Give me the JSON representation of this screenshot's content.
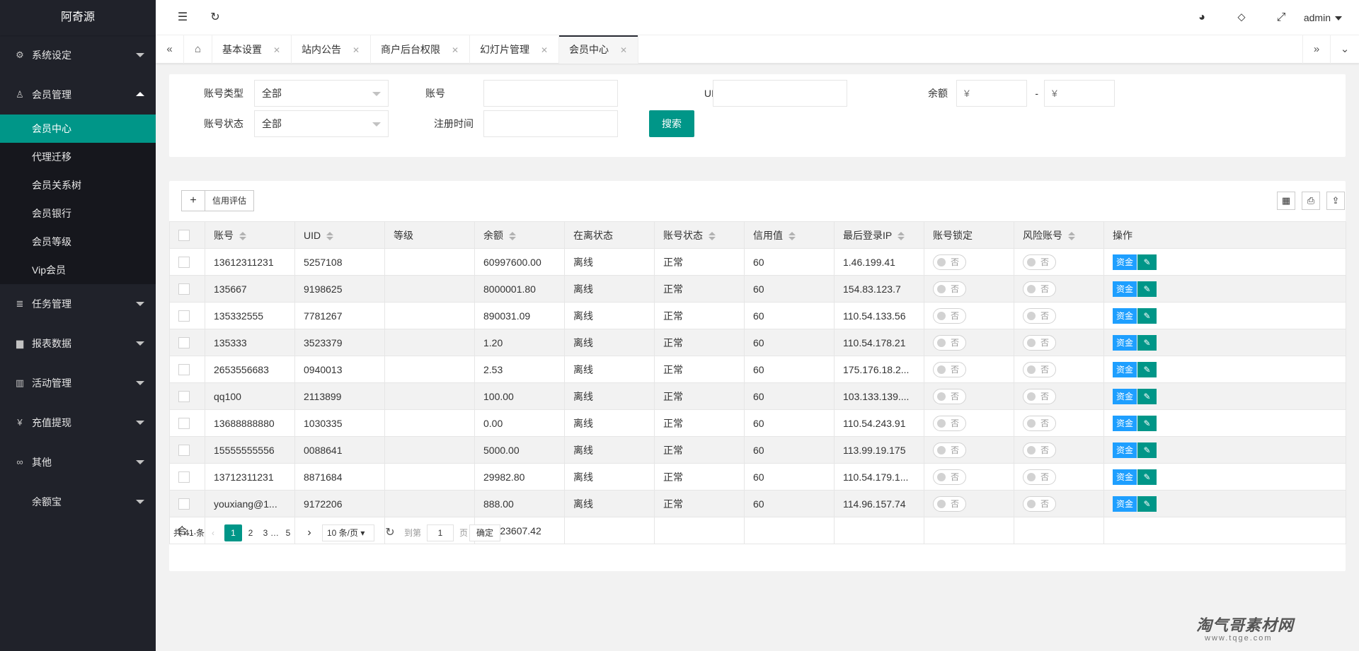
{
  "app": {
    "title": "阿奇源",
    "user": "admin"
  },
  "sidebar": {
    "groups": [
      {
        "label": "系统设定",
        "icon": "gear-icon"
      },
      {
        "label": "会员管理",
        "icon": "user-icon",
        "items": [
          "会员中心",
          "代理迁移",
          "会员关系树",
          "会员银行",
          "会员等级",
          "Vip会员"
        ]
      },
      {
        "label": "任务管理",
        "icon": "task-icon"
      },
      {
        "label": "报表数据",
        "icon": "report-icon"
      },
      {
        "label": "活动管理",
        "icon": "book-icon"
      },
      {
        "label": "充值提现",
        "icon": "yen-icon"
      },
      {
        "label": "其他",
        "icon": "link-icon"
      },
      {
        "label": "余额宝",
        "icon": ""
      }
    ]
  },
  "tabs": [
    "基本设置",
    "站内公告",
    "商户后台权限",
    "幻灯片管理",
    "会员中心"
  ],
  "filters": {
    "account_type_label": "账号类型",
    "account_type_value": "全部",
    "account_label": "账号",
    "account_value": "",
    "uid_label": "UID",
    "uid_value": "",
    "balance_label": "余额",
    "balance_min_ph": "¥",
    "balance_sep": "-",
    "balance_max_ph": "¥",
    "status_label": "账号状态",
    "status_value": "全部",
    "reg_time_label": "注册时间",
    "reg_time_value": "",
    "search_button": "搜索"
  },
  "toolbar": {
    "add": "+",
    "credit": "信用评估"
  },
  "table": {
    "columns": [
      "账号",
      "UID",
      "等级",
      "余额",
      "在离状态",
      "账号状态",
      "信用值",
      "最后登录IP",
      "账号锁定",
      "风险账号",
      "操作"
    ],
    "rows": [
      [
        "13612311231",
        "5257108",
        "",
        "60997600.00",
        "离线",
        "正常",
        "60",
        "1.46.199.41"
      ],
      [
        "135667",
        "9198625",
        "",
        "8000001.80",
        "离线",
        "正常",
        "60",
        "154.83.123.7"
      ],
      [
        "135332555",
        "7781267",
        "",
        "890031.09",
        "离线",
        "正常",
        "60",
        "110.54.133.56"
      ],
      [
        "135333",
        "3523379",
        "",
        "1.20",
        "离线",
        "正常",
        "60",
        "110.54.178.21"
      ],
      [
        "2653556683",
        "0940013",
        "",
        "2.53",
        "离线",
        "正常",
        "60",
        "175.176.18.2..."
      ],
      [
        "qq100",
        "2113899",
        "",
        "100.00",
        "离线",
        "正常",
        "60",
        "103.133.139...."
      ],
      [
        "13688888880",
        "1030335",
        "",
        "0.00",
        "离线",
        "正常",
        "60",
        "110.54.243.91"
      ],
      [
        "15555555556",
        "0088641",
        "",
        "5000.00",
        "离线",
        "正常",
        "60",
        "113.99.19.175"
      ],
      [
        "13712311231",
        "8871684",
        "",
        "29982.80",
        "离线",
        "正常",
        "60",
        "110.54.179.1..."
      ],
      [
        "youxiang@1...",
        "9172206",
        "",
        "888.00",
        "离线",
        "正常",
        "60",
        "114.96.157.74"
      ]
    ],
    "switch_off": "否",
    "op_money": "资金",
    "total_label": "合计",
    "total_balance": "69923607.42"
  },
  "pager": {
    "total": "共 41 条",
    "pages": [
      "1",
      "2",
      "3",
      "…",
      "5"
    ],
    "current": "1",
    "size": "10 条/页",
    "goto_label": "到第",
    "goto_value": "1",
    "page_unit": "页",
    "confirm": "确定"
  },
  "watermark": {
    "text": "淘气哥素材网",
    "url": "www.tqge.com"
  }
}
